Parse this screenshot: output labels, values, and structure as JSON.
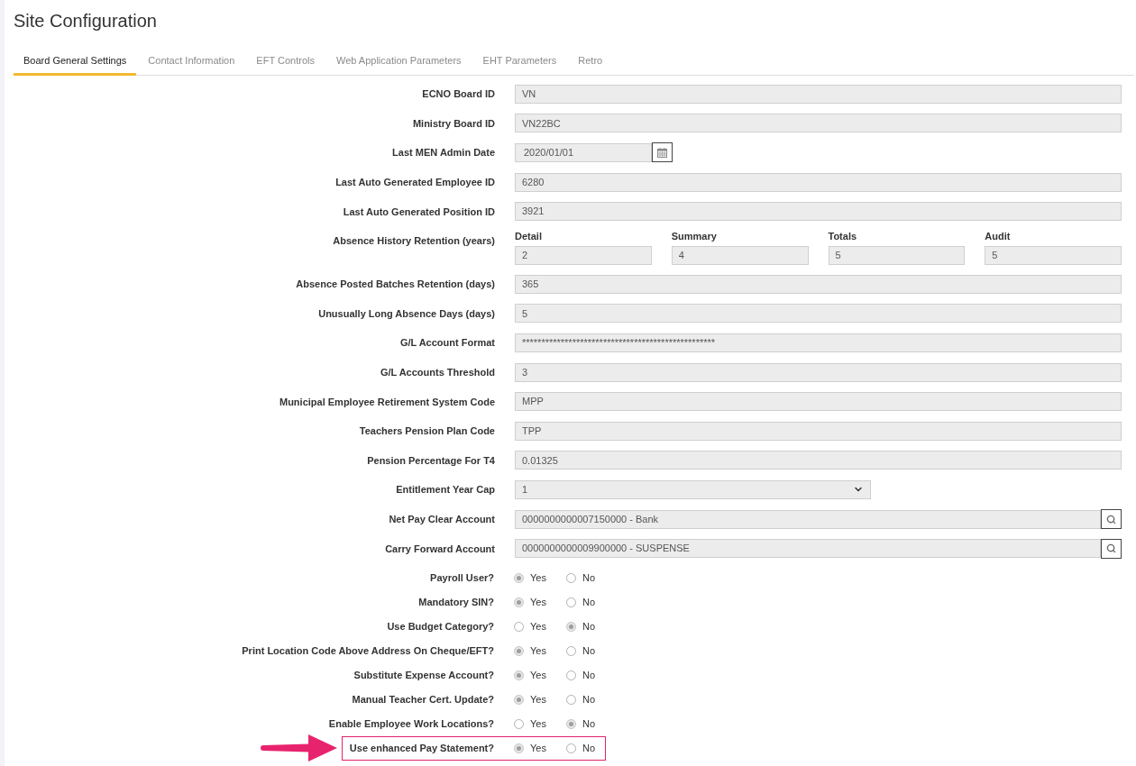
{
  "page": {
    "title": "Site Configuration"
  },
  "tabs": [
    {
      "label": "Board General Settings",
      "selected": true
    },
    {
      "label": "Contact Information",
      "selected": false
    },
    {
      "label": "EFT Controls",
      "selected": false
    },
    {
      "label": "Web Application Parameters",
      "selected": false
    },
    {
      "label": "EHT Parameters",
      "selected": false
    },
    {
      "label": "Retro",
      "selected": false
    }
  ],
  "fields": [
    {
      "kind": "text",
      "label": "ECNO Board ID",
      "value": "VN"
    },
    {
      "kind": "text",
      "label": "Ministry Board ID",
      "value": "VN22BC"
    },
    {
      "kind": "date",
      "label": "Last MEN Admin Date",
      "value": "2020/01/01"
    },
    {
      "kind": "text",
      "label": "Last Auto Generated Employee ID",
      "value": "6280"
    },
    {
      "kind": "text",
      "label": "Last Auto Generated Position ID",
      "value": "3921"
    },
    {
      "kind": "group",
      "label": "Absence History Retention (years)",
      "parts": [
        {
          "label": "Detail",
          "value": "2"
        },
        {
          "label": "Summary",
          "value": "4"
        },
        {
          "label": "Totals",
          "value": "5"
        },
        {
          "label": "Audit",
          "value": "5"
        }
      ]
    },
    {
      "kind": "text",
      "label": "Absence Posted Batches Retention (days)",
      "value": "365"
    },
    {
      "kind": "text",
      "label": "Unusually Long Absence Days (days)",
      "value": "5"
    },
    {
      "kind": "text",
      "label": "G/L Account Format",
      "value": "**************************************************"
    },
    {
      "kind": "text",
      "label": "G/L Accounts Threshold",
      "value": "3"
    },
    {
      "kind": "text",
      "label": "Municipal Employee Retirement System Code",
      "value": "MPP"
    },
    {
      "kind": "text",
      "label": "Teachers Pension Plan Code",
      "value": "TPP"
    },
    {
      "kind": "text",
      "label": "Pension Percentage For T4",
      "value": "0.01325"
    },
    {
      "kind": "select",
      "label": "Entitlement Year Cap",
      "value": "1"
    },
    {
      "kind": "lookup",
      "label": "Net Pay Clear Account",
      "value": "0000000000007150000 - Bank"
    },
    {
      "kind": "lookup",
      "label": "Carry Forward Account",
      "value": "0000000000009900000 - SUSPENSE"
    }
  ],
  "options": [
    {
      "label": "Payroll User?",
      "highlighted": false,
      "choices": [
        {
          "label": "Yes",
          "selected": true
        },
        {
          "label": "No",
          "selected": false
        }
      ]
    },
    {
      "label": "Mandatory SIN?",
      "highlighted": false,
      "choices": [
        {
          "label": "Yes",
          "selected": true
        },
        {
          "label": "No",
          "selected": false
        }
      ]
    },
    {
      "label": "Use Budget Category?",
      "highlighted": false,
      "choices": [
        {
          "label": "Yes",
          "selected": false
        },
        {
          "label": "No",
          "selected": true
        }
      ]
    },
    {
      "label": "Print Location Code Above Address On Cheque/EFT?",
      "highlighted": false,
      "choices": [
        {
          "label": "Yes",
          "selected": true
        },
        {
          "label": "No",
          "selected": false
        }
      ]
    },
    {
      "label": "Substitute Expense Account?",
      "highlighted": false,
      "choices": [
        {
          "label": "Yes",
          "selected": true
        },
        {
          "label": "No",
          "selected": false
        }
      ]
    },
    {
      "label": "Manual Teacher Cert. Update?",
      "highlighted": false,
      "choices": [
        {
          "label": "Yes",
          "selected": true
        },
        {
          "label": "No",
          "selected": false
        }
      ]
    },
    {
      "label": "Enable Employee Work Locations?",
      "highlighted": false,
      "choices": [
        {
          "label": "Yes",
          "selected": false
        },
        {
          "label": "No",
          "selected": true
        }
      ]
    },
    {
      "label": "Use enhanced Pay Statement?",
      "highlighted": true,
      "choices": [
        {
          "label": "Yes",
          "selected": true
        },
        {
          "label": "No",
          "selected": false
        }
      ]
    }
  ]
}
